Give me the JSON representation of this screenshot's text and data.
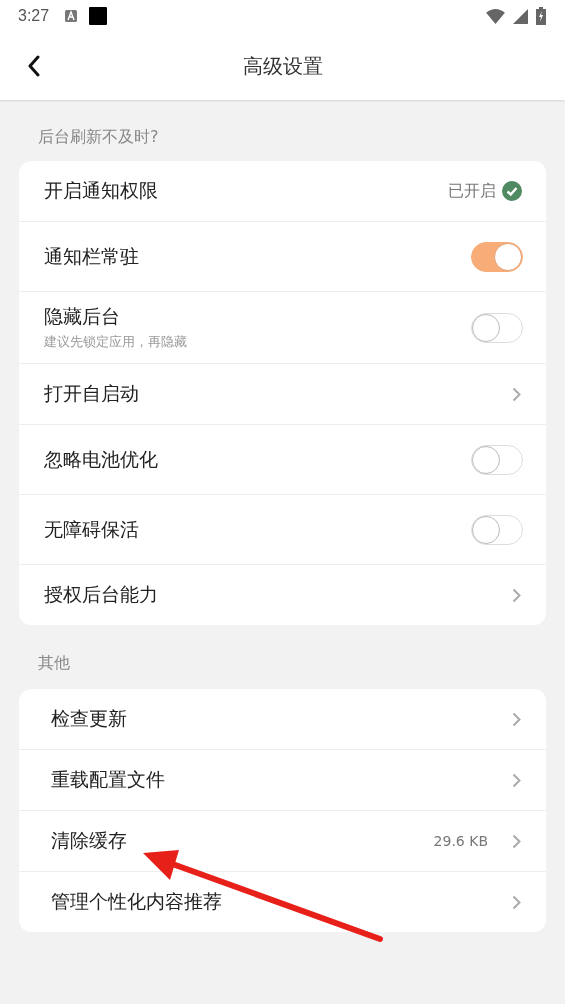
{
  "status_bar": {
    "time": "3:27"
  },
  "header": {
    "title": "高级设置"
  },
  "sections": [
    {
      "title": "后台刷新不及时?",
      "items": [
        {
          "kind": "status",
          "label": "开启通知权限",
          "value": "已开启"
        },
        {
          "kind": "toggle",
          "label": "通知栏常驻",
          "on": true
        },
        {
          "kind": "toggle",
          "label": "隐藏后台",
          "subtitle": "建议先锁定应用，再隐藏",
          "on": false
        },
        {
          "kind": "link",
          "label": "打开自启动"
        },
        {
          "kind": "toggle",
          "label": "忽略电池优化",
          "on": false
        },
        {
          "kind": "toggle",
          "label": "无障碍保活",
          "on": false
        },
        {
          "kind": "link",
          "label": "授权后台能力"
        }
      ]
    },
    {
      "title": "其他",
      "items": [
        {
          "kind": "link",
          "label": "检查更新"
        },
        {
          "kind": "link",
          "label": "重载配置文件"
        },
        {
          "kind": "link",
          "label": "清除缓存",
          "value": "29.6 KB"
        },
        {
          "kind": "link",
          "label": "管理个性化内容推荐"
        }
      ]
    }
  ],
  "annotation": {
    "kind": "arrow",
    "color": "#e8201a"
  }
}
